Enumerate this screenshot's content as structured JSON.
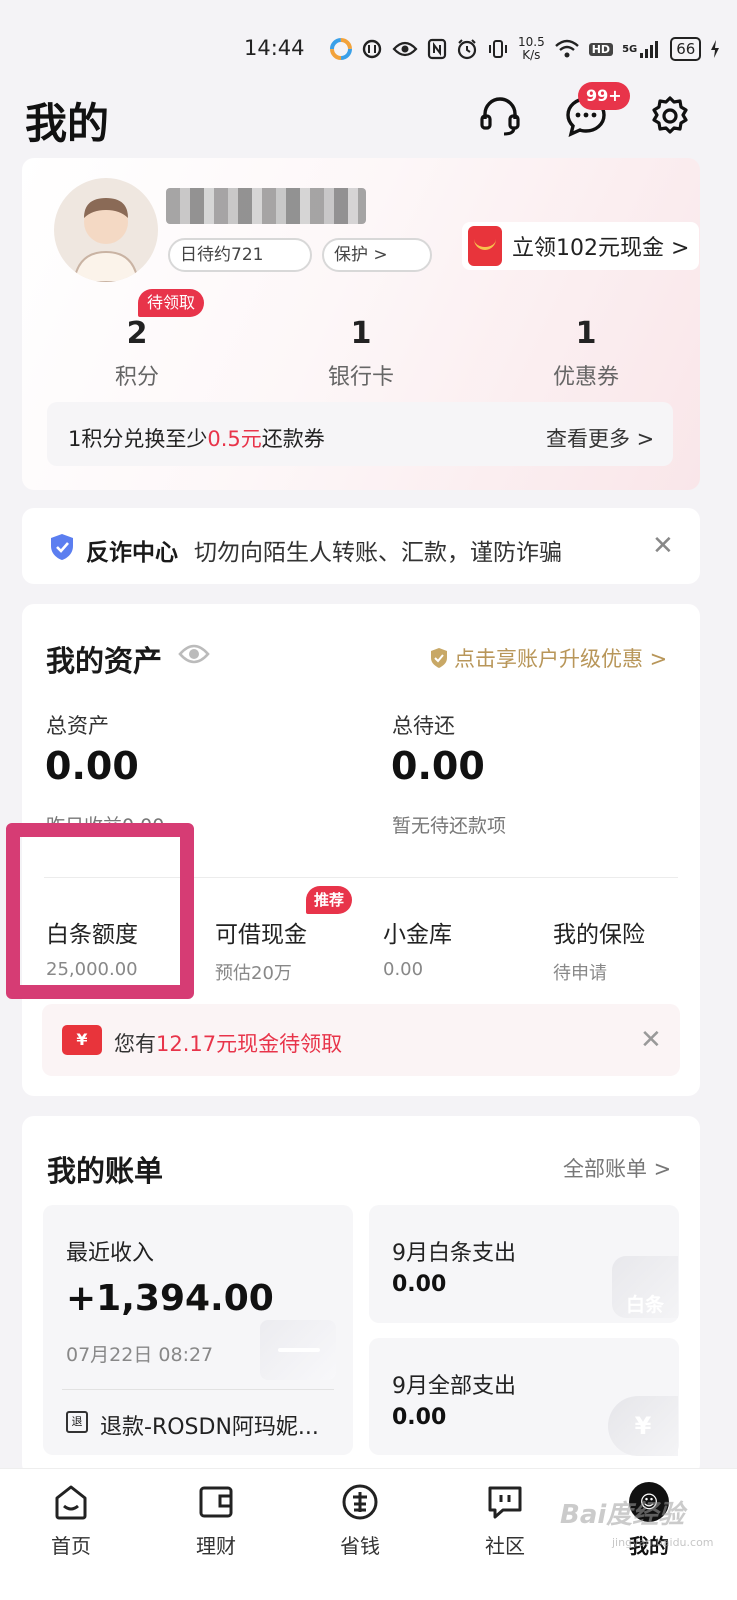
{
  "status_bar": {
    "time": "14:44",
    "net_speed_top": "10.5",
    "net_speed_bottom": "K/s",
    "hd": "HD",
    "signal": "5G",
    "battery": "66"
  },
  "header": {
    "title": "我的",
    "message_badge": "99+"
  },
  "profile": {
    "tag1": "日待约721",
    "tag2": "保护 >",
    "cash_promo": "立领102元现金 >",
    "stats": [
      {
        "value": "2",
        "label": "积分"
      },
      {
        "value": "1",
        "label": "银行卡"
      },
      {
        "value": "1",
        "label": "优惠券"
      }
    ],
    "pending_badge": "待领取",
    "points_text_prefix": "1积分兑换至少",
    "points_text_highlight": "0.5元",
    "points_text_suffix": "还款券",
    "points_more": "查看更多 >"
  },
  "fraud": {
    "title": "反诈中心",
    "text": "切勿向陌生人转账、汇款，谨防诈骗",
    "close": "✕"
  },
  "assets": {
    "title": "我的资产",
    "upgrade": "点击享账户升级优惠 >",
    "total_label": "总资产",
    "total_value": "0.00",
    "total_sub": "昨日收益0.00",
    "due_label": "总待还",
    "due_value": "0.00",
    "due_sub": "暂无待还款项",
    "quick_items": [
      {
        "label": "白条额度",
        "sub": "25,000.00"
      },
      {
        "label": "可借现金",
        "sub": "预估20万"
      },
      {
        "label": "小金库",
        "sub": "0.00"
      },
      {
        "label": "我的保险",
        "sub": "待申请"
      }
    ],
    "recommend_badge": "推荐",
    "cash_banner_prefix": "您有",
    "cash_banner_highlight": "12.17元现金待领取",
    "cash_banner_close": "✕"
  },
  "bills": {
    "title": "我的账单",
    "all": "全部账单 >",
    "income_label": "最近收入",
    "income_amount": "+1,394.00",
    "income_time": "07月22日 08:27",
    "refund_text": "退款-ROSDN阿玛妮...",
    "refund_icon": "退",
    "baitiao_label": "9月白条支出",
    "baitiao_value": "0.00",
    "baitiao_deco": "白条",
    "all_label": "9月全部支出",
    "all_value": "0.00",
    "yen": "¥"
  },
  "tabbar": {
    "tabs": [
      {
        "label": "首页",
        "icon": "home-icon"
      },
      {
        "label": "理财",
        "icon": "wallet-icon"
      },
      {
        "label": "省钱",
        "icon": "save-icon"
      },
      {
        "label": "社区",
        "icon": "community-icon"
      },
      {
        "label": "我的",
        "icon": "mine-icon"
      }
    ],
    "mine_glyph": "☺"
  },
  "watermark": {
    "main": "Bai度经验",
    "sub": "jingyan.baidu.com"
  },
  "colors": {
    "accent_red": "#e8344a",
    "gold": "#b89659",
    "highlight_frame": "#d63c74"
  }
}
